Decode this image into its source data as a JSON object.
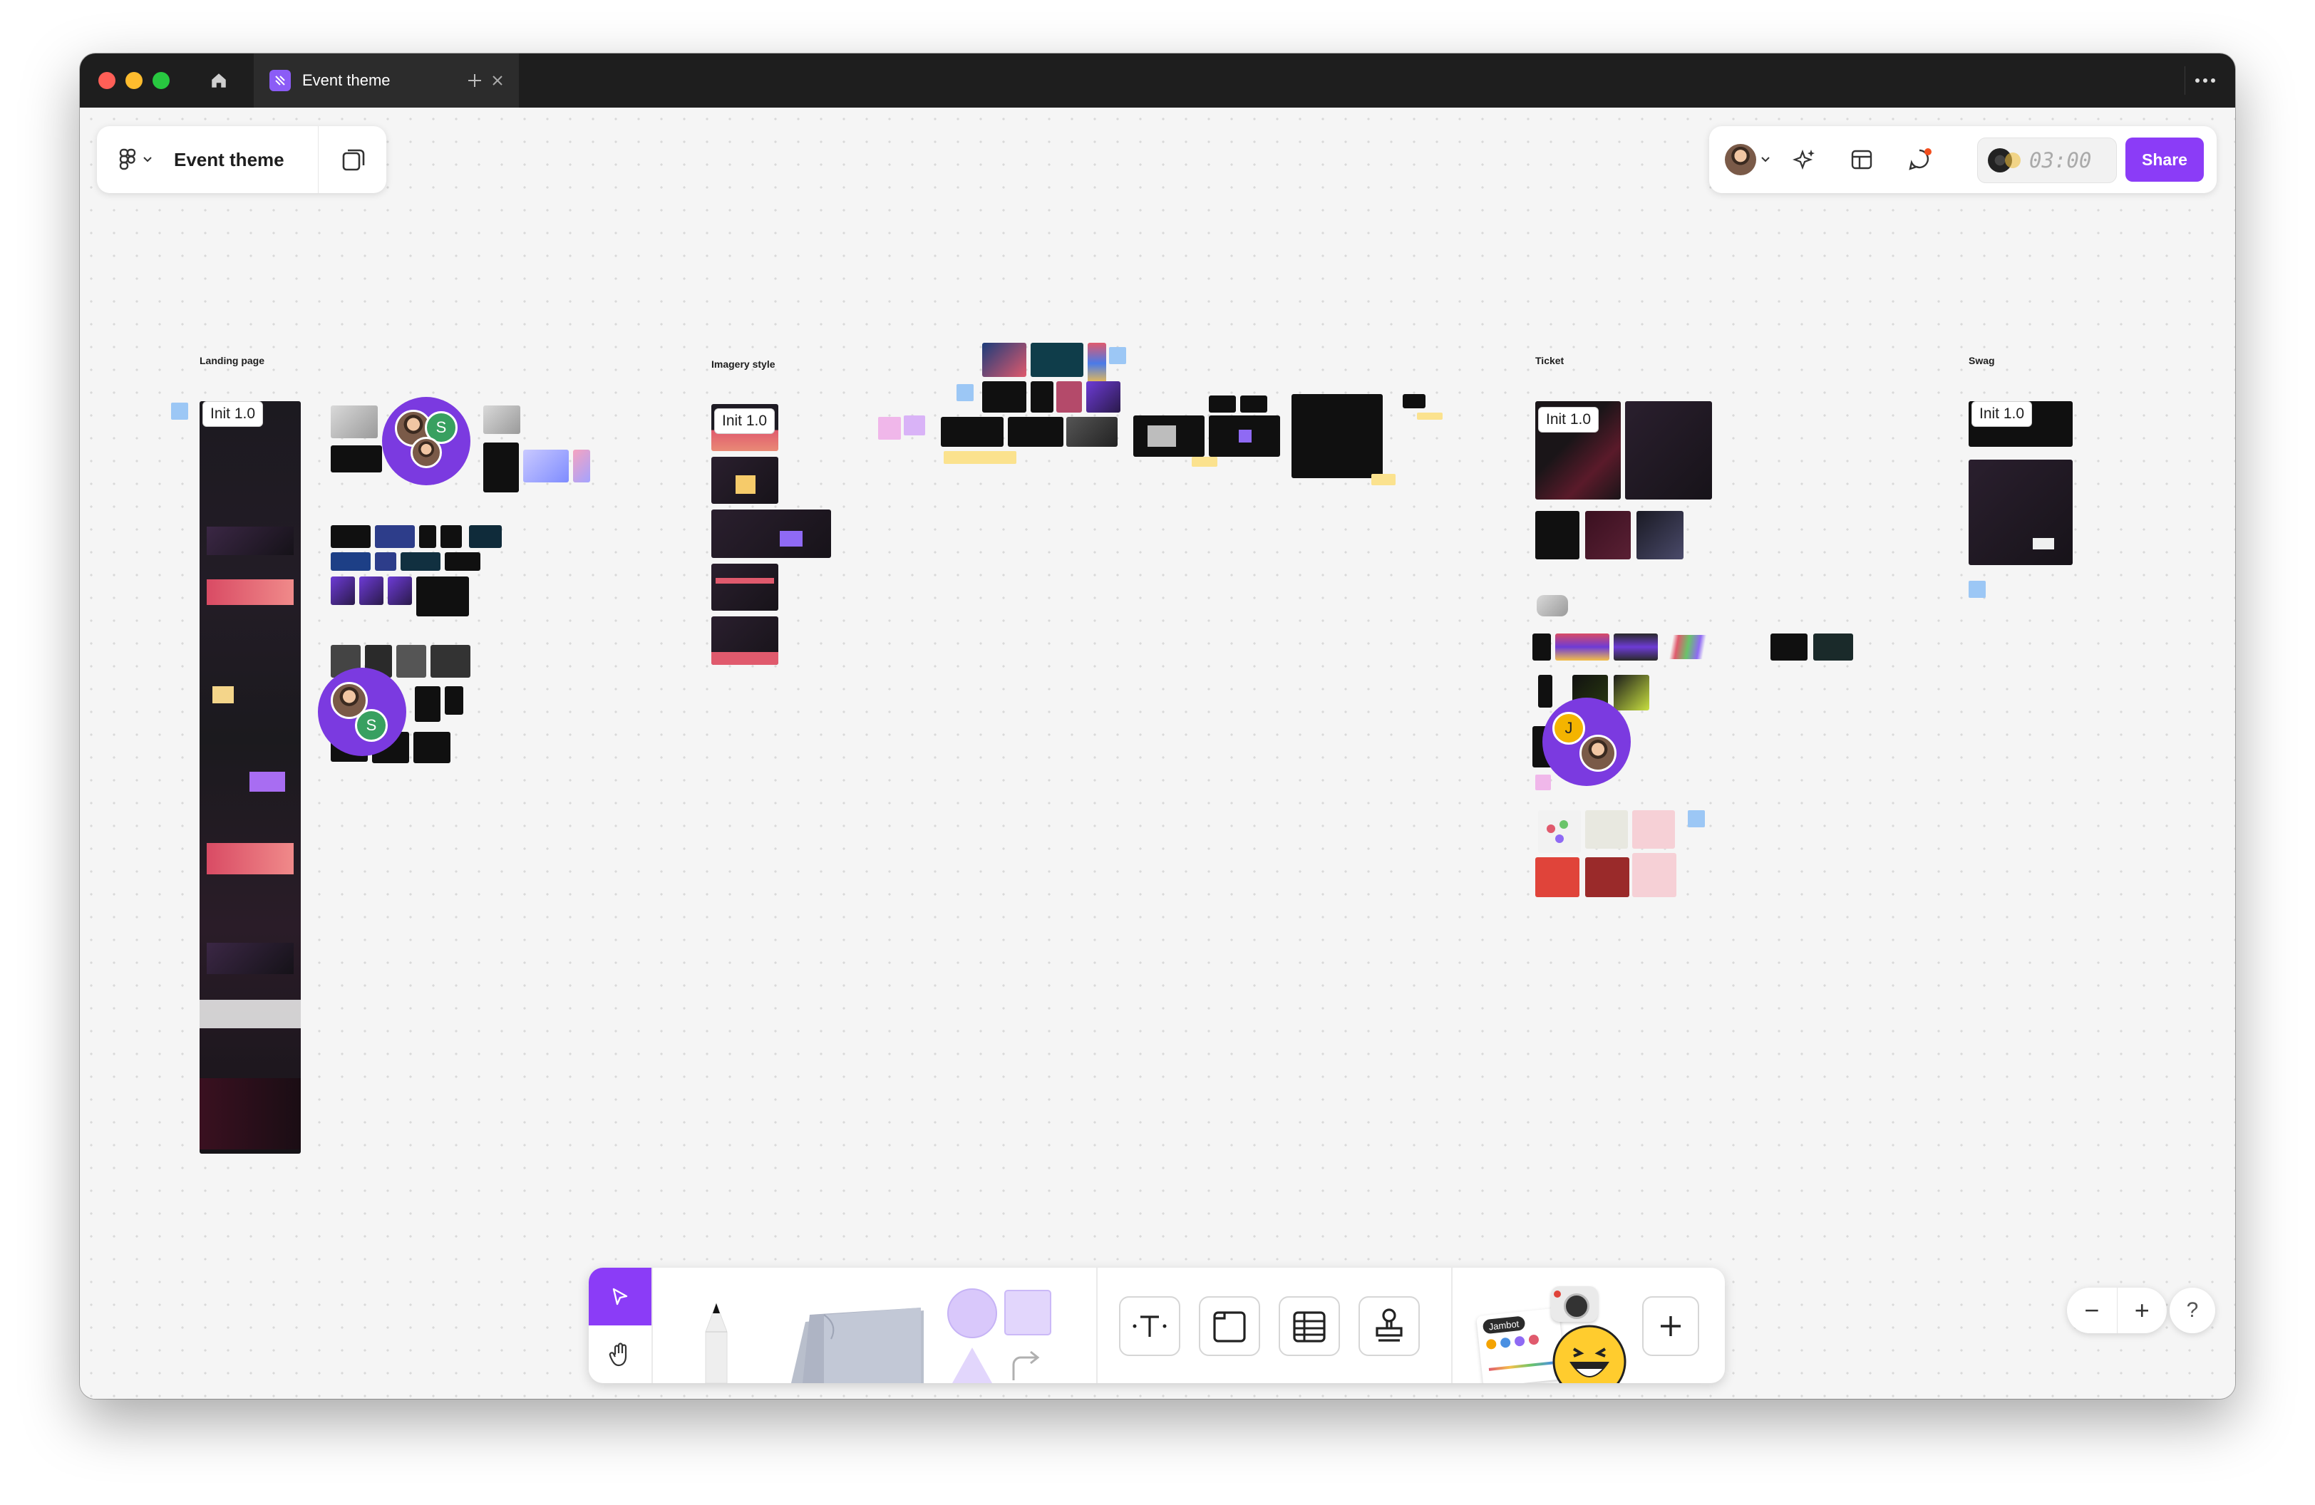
{
  "window": {
    "tab_title": "Event theme",
    "brand_color": "#8B3CF7"
  },
  "file_panel": {
    "menu_icon": "figjam-logo-icon",
    "title": "Event theme",
    "pages_icon": "pages-icon"
  },
  "top_panel": {
    "timer": "03:00",
    "share_label": "Share",
    "icons": [
      "avatar",
      "ai-sparkle-icon",
      "templates-icon",
      "comments-icon",
      "music-timer-icon"
    ]
  },
  "board": {
    "sections": [
      {
        "label": "Landing page",
        "badge": "Init 1.0"
      },
      {
        "label": "Imagery style",
        "badge": "Init 1.0"
      },
      {
        "label": "Ticket",
        "badge": "Init 1.0"
      },
      {
        "label": "Swag",
        "badge": "Init 1.0"
      }
    ],
    "cursors": [
      {
        "initial": "S"
      },
      {
        "initial": "S"
      },
      {
        "initial": "J"
      }
    ]
  },
  "toolbar": {
    "tools": [
      "select-tool",
      "hand-tool",
      "pen-tool",
      "sticky-note-tool",
      "shape-tool",
      "text-tool",
      "section-tool",
      "table-tool",
      "stamp-tool",
      "jambot-widget",
      "more-tools"
    ],
    "widget_label": "Jambot",
    "plus": "+"
  },
  "zoom": {
    "minus": "−",
    "plus": "+",
    "help": "?"
  }
}
